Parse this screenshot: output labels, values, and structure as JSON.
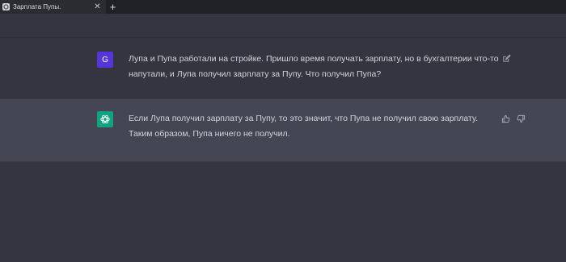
{
  "browser": {
    "tab_title": "Зарплата Пупы.",
    "close_symbol": "✕",
    "new_tab_symbol": "+"
  },
  "conversation": {
    "user_message": {
      "avatar_letter": "G",
      "text": "Лупа и Пупа работали на стройке. Пришло время получать зарплату, но в бухгалтерии что-то напутали, и Лупа получил зарплату за Пупу. Что получил Пупа?"
    },
    "assistant_message": {
      "text": "Если Лупа получил зарплату за Пупу, то это значит, что Пупа не получил свою зарплату. Таким образом, Пупа ничего не получил."
    }
  },
  "colors": {
    "user_avatar": "#5436da",
    "assistant_avatar": "#10a37f",
    "assistant_bg": "#444654",
    "page_bg": "#343541"
  },
  "icons": [
    "chatgpt-favicon",
    "close-icon",
    "plus-icon",
    "edit-icon",
    "openai-logo-icon",
    "thumbs-up-icon",
    "thumbs-down-icon"
  ]
}
